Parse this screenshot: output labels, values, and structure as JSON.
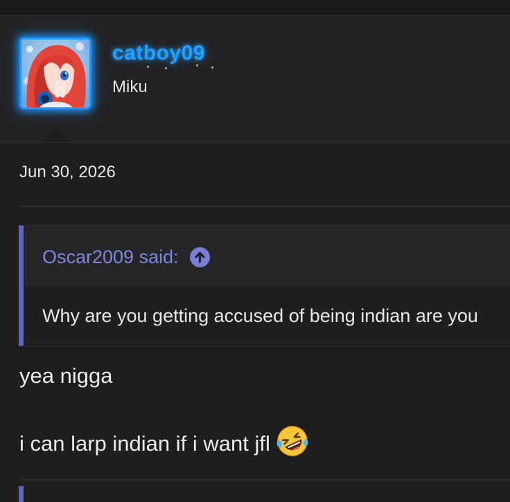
{
  "post": {
    "username": "catboy09",
    "user_title": "Miku",
    "date": "Jun 30, 2026",
    "avatar_icon": "anime-avatar-icon",
    "accent_color": "#1e95ff"
  },
  "quote": {
    "author_label": "Oscar2009 said:",
    "jump_icon": "arrow-up-circle-icon",
    "text": "Why are you getting accused of being indian are you",
    "accent_color": "#5e63c9"
  },
  "message": {
    "line1": "yea nigga",
    "line2": "i can larp indian if i want jfl",
    "emoji_icon": "rolling-on-floor-laughing-emoji-icon"
  }
}
